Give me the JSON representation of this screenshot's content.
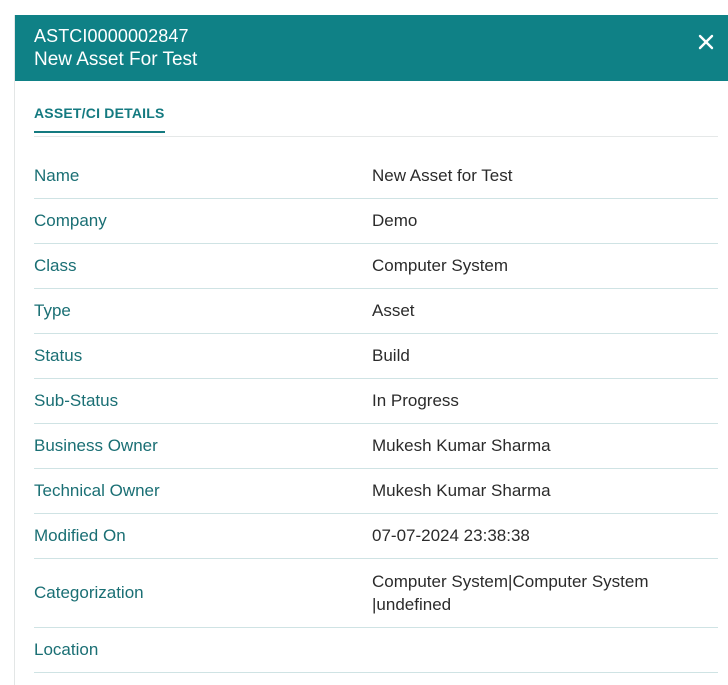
{
  "header": {
    "asset_id": "ASTCI0000002847",
    "asset_name": "New Asset For Test",
    "background_color": "#0f8186",
    "close_icon": "close-icon"
  },
  "tabs": [
    {
      "label": "ASSET/CI DETAILS",
      "active": true
    }
  ],
  "details": [
    {
      "label": "Name",
      "value": "New Asset for Test"
    },
    {
      "label": "Company",
      "value": "Demo"
    },
    {
      "label": "Class",
      "value": "Computer System"
    },
    {
      "label": "Type",
      "value": "Asset"
    },
    {
      "label": "Status",
      "value": "Build"
    },
    {
      "label": "Sub-Status",
      "value": "In Progress"
    },
    {
      "label": "Business Owner",
      "value": "Mukesh Kumar Sharma"
    },
    {
      "label": "Technical Owner",
      "value": "Mukesh Kumar Sharma"
    },
    {
      "label": "Modified On",
      "value": "07-07-2024 23:38:38"
    },
    {
      "label": "Categorization",
      "value": "Computer System|Computer System |undefined"
    },
    {
      "label": "Location",
      "value": ""
    }
  ]
}
